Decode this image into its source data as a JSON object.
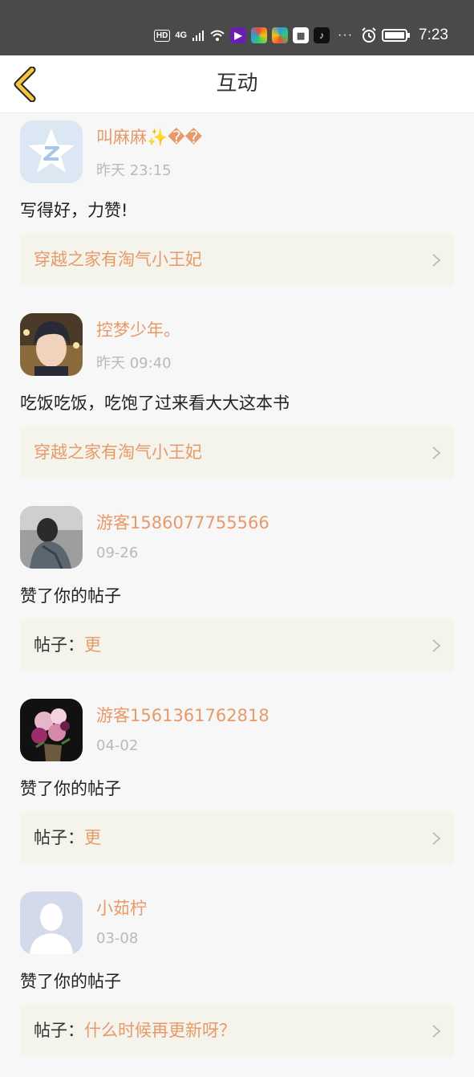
{
  "status_bar": {
    "hd": "HD",
    "network": "4G",
    "more": "···",
    "time": "7:23"
  },
  "header": {
    "title": "互动",
    "back_icon": "chevron-left-icon"
  },
  "colors": {
    "accent": "#e79a69",
    "back": "#f4c542",
    "ref_bg": "#f4f3ec",
    "meta": "#b9b9b9"
  },
  "feed": {
    "items": [
      {
        "name": "叫麻麻✨��",
        "time": "昨天 23:15",
        "content": "写得好，力赞!",
        "ref_prefix": "",
        "ref_title": "穿越之家有淘气小王妃",
        "avatar": "qq-logo-avatar"
      },
      {
        "name": "控梦少年。",
        "time": "昨天 09:40",
        "content": "吃饭吃饭，吃饱了过来看大大这本书",
        "ref_prefix": "",
        "ref_title": "穿越之家有淘气小王妃",
        "avatar": "boy-photo-avatar"
      },
      {
        "name": "游客1586077755566",
        "time": "09-26",
        "content": "赞了你的帖子",
        "ref_prefix": "帖子：",
        "ref_title": "更",
        "avatar": "girl-photo-avatar"
      },
      {
        "name": "游客1561361762818",
        "time": "04-02",
        "content": "赞了你的帖子",
        "ref_prefix": "帖子：",
        "ref_title": "更",
        "avatar": "flowers-photo-avatar"
      },
      {
        "name": "小茹柠",
        "time": "03-08",
        "content": "赞了你的帖子",
        "ref_prefix": "帖子：",
        "ref_title": "什么时候再更新呀？",
        "avatar": "default-person-avatar"
      }
    ]
  }
}
